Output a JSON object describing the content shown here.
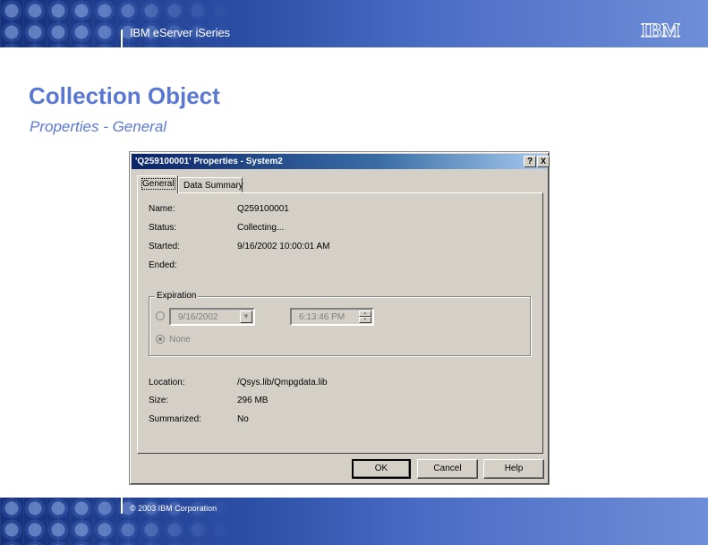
{
  "header": {
    "title": "IBM eServer iSeries",
    "logo_text": "IBM"
  },
  "footer": {
    "copyright": "© 2003 IBM Corporation"
  },
  "slide": {
    "title": "Collection Object",
    "subtitle": "Properties - General"
  },
  "dialog": {
    "title": "'Q259100001' Properties - System2",
    "help_button": "?",
    "close_button": "X",
    "tabs": [
      {
        "label": "General",
        "active": true
      },
      {
        "label": "Data Summary",
        "active": false
      }
    ],
    "fields": [
      {
        "label": "Name:",
        "value": "Q259100001"
      },
      {
        "label": "Status:",
        "value": "Collecting..."
      },
      {
        "label": "Started:",
        "value": "9/16/2002 10:00:01 AM"
      },
      {
        "label": "Ended:",
        "value": ""
      }
    ],
    "expiration": {
      "legend": "Expiration",
      "date_value": "9/16/2002",
      "time_value": "6:13:46 PM",
      "none_label": "None",
      "selected": "none"
    },
    "details": [
      {
        "label": "Location:",
        "value": "/Qsys.lib/Qmpgdata.lib"
      },
      {
        "label": "Size:",
        "value": "296 MB"
      },
      {
        "label": "Summarized:",
        "value": "No"
      }
    ],
    "buttons": {
      "ok": "OK",
      "cancel": "Cancel",
      "help": "Help"
    }
  },
  "colors": {
    "accent": "#5a78d2",
    "titlebar": "#0a246a",
    "dialog_bg": "#d4d0c8"
  }
}
